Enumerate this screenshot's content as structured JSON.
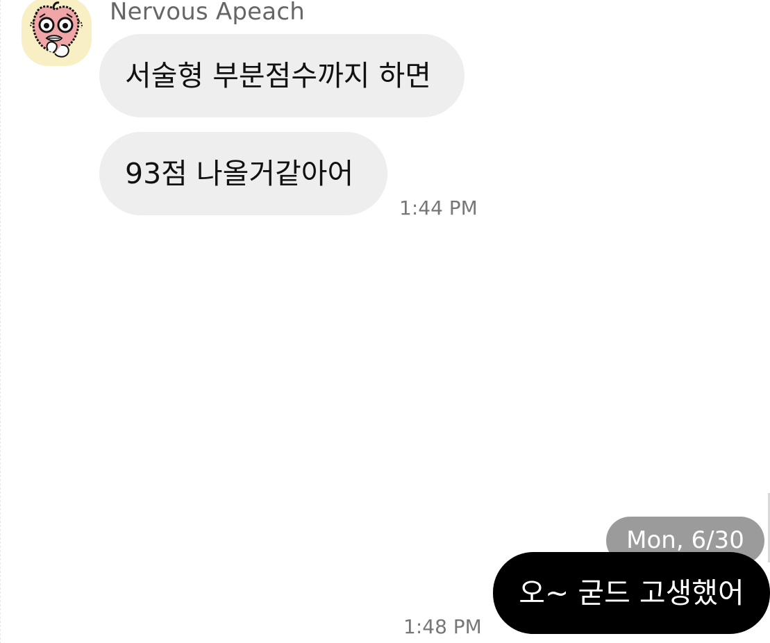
{
  "conversation": {
    "sender_name": "Nervous Apeach",
    "incoming_messages": [
      "서술형 부분점수까지 하면",
      "93점 나올거같아어"
    ],
    "incoming_time": "1:44 PM",
    "date_label": "Mon, 6/30",
    "outgoing_message": "오~ 굳드 고생했어",
    "outgoing_time": "1:48 PM"
  },
  "icons": {
    "avatar": "nervous-peach-character-icon"
  },
  "colors": {
    "incoming_bubble": "#eeeeee",
    "outgoing_bubble": "#000000",
    "date_pill": "#9b9b9b",
    "avatar_background": "#f8efc5",
    "name_text": "#666666",
    "time_text": "#777777"
  }
}
